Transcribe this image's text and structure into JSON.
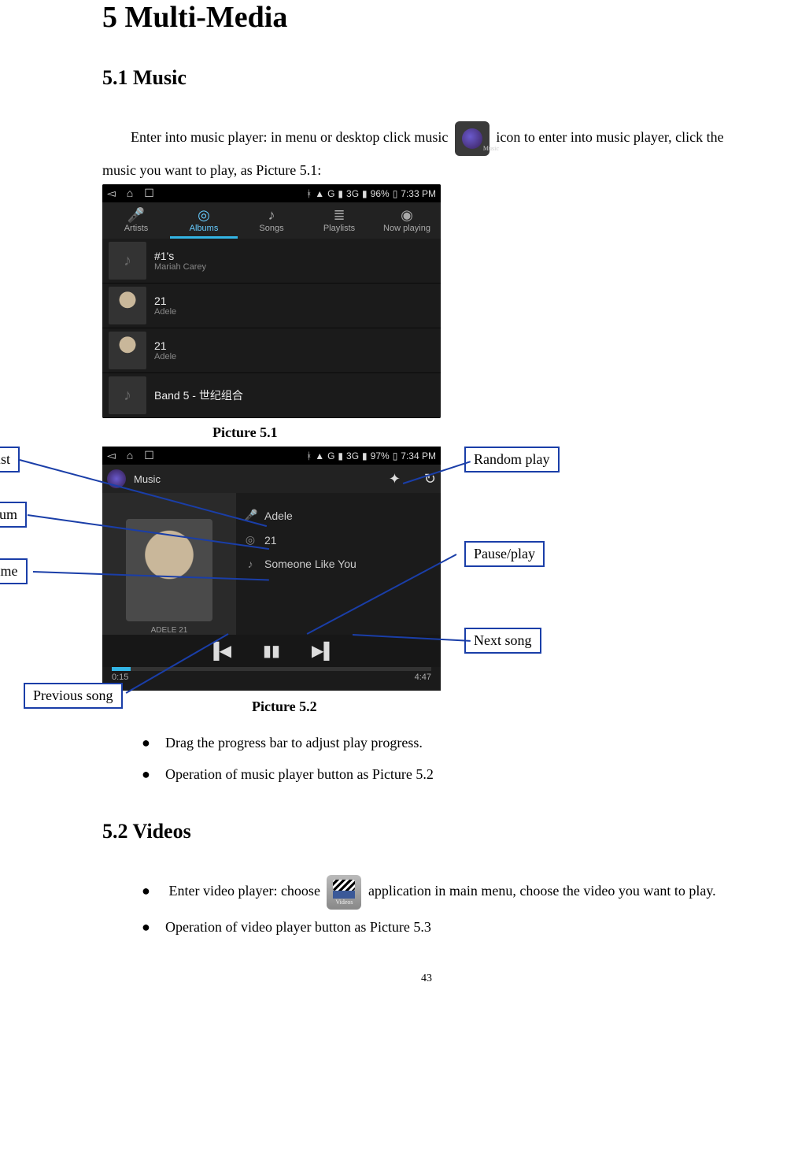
{
  "doc": {
    "chapter_title": "5 Multi-Media",
    "sec1_title": "5.1 Music",
    "intro_p1_a": "Enter into music player: in menu or desktop click music ",
    "intro_p1_b": " icon to enter into music player, click the music you want to play, as Picture 5.1:",
    "caption1": "Picture 5.1",
    "caption2": "Picture 5.2",
    "bullet1": "Drag the progress bar to adjust play progress.",
    "bullet2": "Operation of music player button as Picture 5.2",
    "sec2_title": "5.2 Videos",
    "bullet3_a": "Enter video player: choose ",
    "bullet3_b": "application in main menu, choose the video you want to play.",
    "bullet4": "Operation of video player button as Picture 5.3",
    "page_number": "43",
    "music_icon_label": "Music",
    "video_icon_label": "Videos"
  },
  "shot1": {
    "status_battery": "96%",
    "status_time": "7:33 PM",
    "network_label": "3G",
    "tabs": [
      "Artists",
      "Albums",
      "Songs",
      "Playlists",
      "Now playing"
    ],
    "active_tab_index": 1,
    "albums": [
      {
        "title": "#1's",
        "artist": "Mariah Carey"
      },
      {
        "title": "21",
        "artist": "Adele"
      },
      {
        "title": "21",
        "artist": "Adele"
      },
      {
        "title": "Band 5 - 世纪组合",
        "artist": ""
      }
    ]
  },
  "shot2": {
    "status_battery": "97%",
    "status_time": "7:34 PM",
    "network_label": "3G",
    "app_title": "Music",
    "artist": "Adele",
    "album": "21",
    "song": "Someone Like You",
    "cover_caption": "ADELE 21",
    "elapsed": "0:15",
    "total": "4:47"
  },
  "callouts": {
    "artist": "Artist",
    "album": "Album",
    "song_name": "Song name",
    "previous": "Previous song",
    "random": "Random play",
    "pause": "Pause/play",
    "next": "Next song"
  }
}
